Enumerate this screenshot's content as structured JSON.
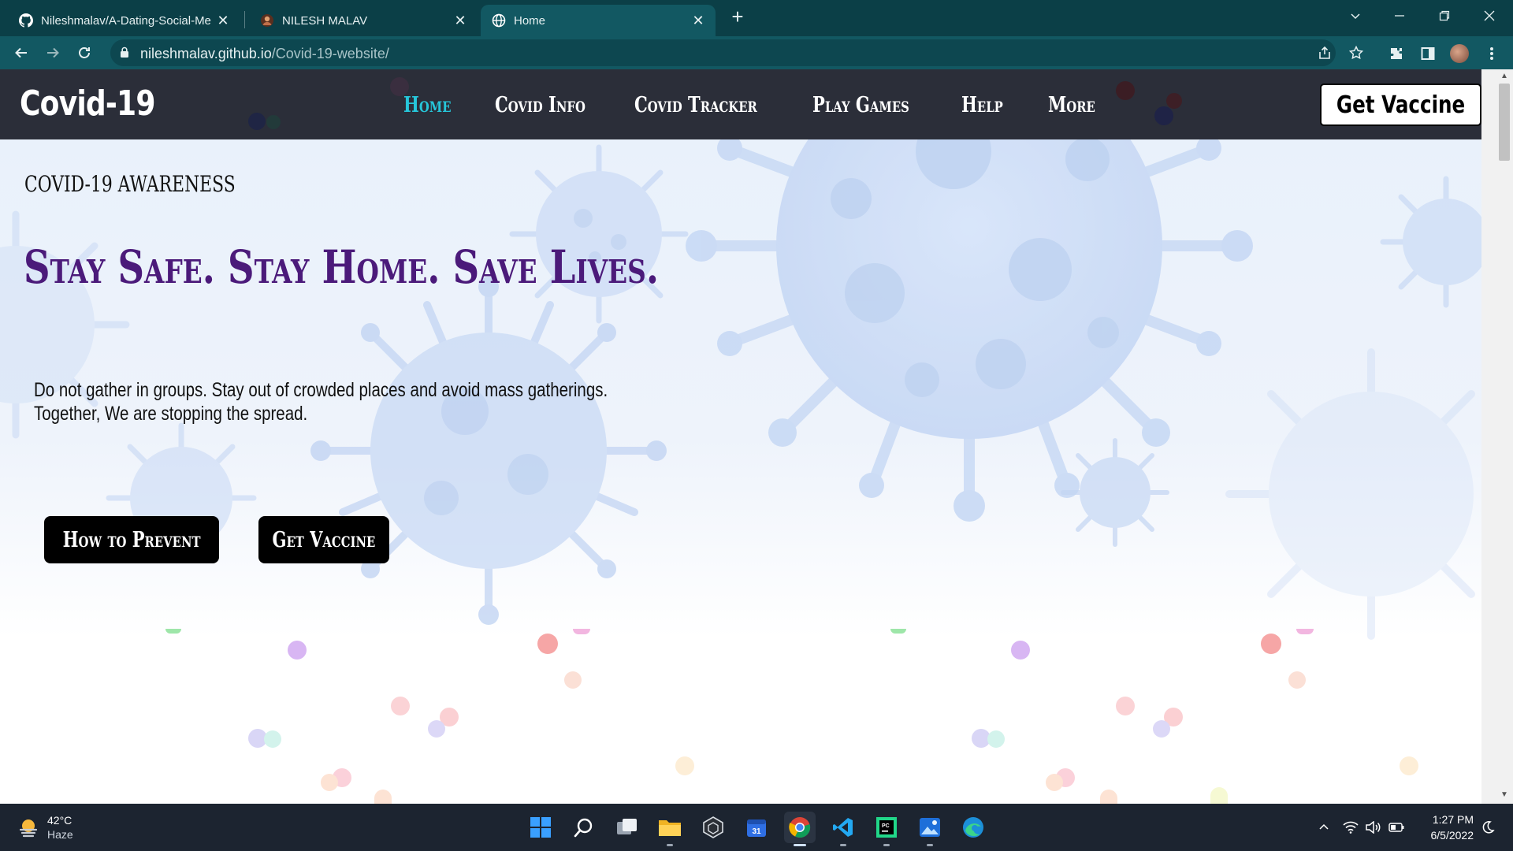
{
  "browser": {
    "tabs": [
      {
        "title": "Nileshmalav/A-Dating-Social-Me",
        "icon": "github-icon"
      },
      {
        "title": "NILESH MALAV",
        "icon": "profile-icon"
      },
      {
        "title": "Home",
        "icon": "globe-icon"
      }
    ],
    "active_tab": 2,
    "url": {
      "host": "nileshmalav.github.io",
      "path": "/Covid-19-website/"
    }
  },
  "site": {
    "logo": "Covid-19",
    "nav": [
      "Home",
      "Covid Info",
      "Covid Tracker",
      "Play Games",
      "Help",
      "More"
    ],
    "active_nav": "Home",
    "cta_label": "Get Vaccine"
  },
  "hero": {
    "eyebrow": "COVID-19 AWARENESS",
    "headline": "Stay Safe. Stay Home. Save Lives.",
    "body_line1": "Do not gather in groups. Stay out of crowded places and avoid mass gatherings.",
    "body_line2": "Together, We are stopping the spread.",
    "btn_prevent": "How to Prevent",
    "btn_vaccine": "Get Vaccine"
  },
  "taskbar": {
    "weather": {
      "temp": "42°C",
      "condition": "Haze"
    },
    "time": "1:27 PM",
    "date": "6/5/2022"
  },
  "colors": {
    "tabstrip": "#0b3f47",
    "toolbar": "#125862",
    "site_nav": "#2b2e39",
    "active_nav": "#26c6da",
    "headline": "#4b1a7a",
    "taskbar": "#1c2430"
  }
}
